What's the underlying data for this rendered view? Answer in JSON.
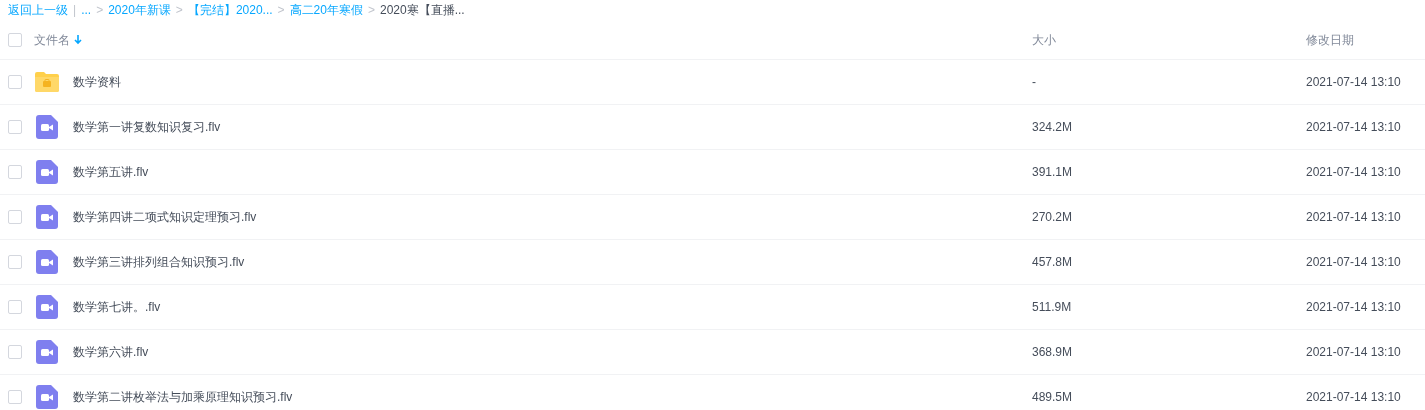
{
  "breadcrumb": [
    {
      "kind": "link",
      "text": "返回上一级"
    },
    {
      "kind": "divider",
      "text": "|"
    },
    {
      "kind": "link",
      "text": "..."
    },
    {
      "kind": "separator",
      "text": ">"
    },
    {
      "kind": "link",
      "text": "2020年新课"
    },
    {
      "kind": "separator",
      "text": ">"
    },
    {
      "kind": "link",
      "text": "【完结】2020..."
    },
    {
      "kind": "separator",
      "text": ">"
    },
    {
      "kind": "link",
      "text": "高二20年寒假"
    },
    {
      "kind": "separator",
      "text": ">"
    },
    {
      "kind": "current",
      "text": "2020寒【直播..."
    }
  ],
  "table": {
    "select_all": {
      "checked": false
    },
    "columns": [
      {
        "label": "文件名",
        "sorted": true
      },
      {
        "label": "大小",
        "sorted": false
      },
      {
        "label": "修改日期",
        "sorted": false
      }
    ],
    "rows": [
      {
        "kind": "folder",
        "checked": false,
        "name": "数学资料",
        "size": "-",
        "modified": "2021-07-14 13:10"
      },
      {
        "kind": "video",
        "checked": false,
        "name": "数学第一讲复数知识复习.flv",
        "size": "324.2M",
        "modified": "2021-07-14 13:10"
      },
      {
        "kind": "video",
        "checked": false,
        "name": "数学第五讲.flv",
        "size": "391.1M",
        "modified": "2021-07-14 13:10"
      },
      {
        "kind": "video",
        "checked": false,
        "name": "数学第四讲二项式知识定理预习.flv",
        "size": "270.2M",
        "modified": "2021-07-14 13:10"
      },
      {
        "kind": "video",
        "checked": false,
        "name": "数学第三讲排列组合知识预习.flv",
        "size": "457.8M",
        "modified": "2021-07-14 13:10"
      },
      {
        "kind": "video",
        "checked": false,
        "name": "数学第七讲。.flv",
        "size": "511.9M",
        "modified": "2021-07-14 13:10"
      },
      {
        "kind": "video",
        "checked": false,
        "name": "数学第六讲.flv",
        "size": "368.9M",
        "modified": "2021-07-14 13:10"
      },
      {
        "kind": "video",
        "checked": false,
        "name": "数学第二讲枚举法与加乘原理知识预习.flv",
        "size": "489.5M",
        "modified": "2021-07-14 13:10"
      }
    ]
  }
}
